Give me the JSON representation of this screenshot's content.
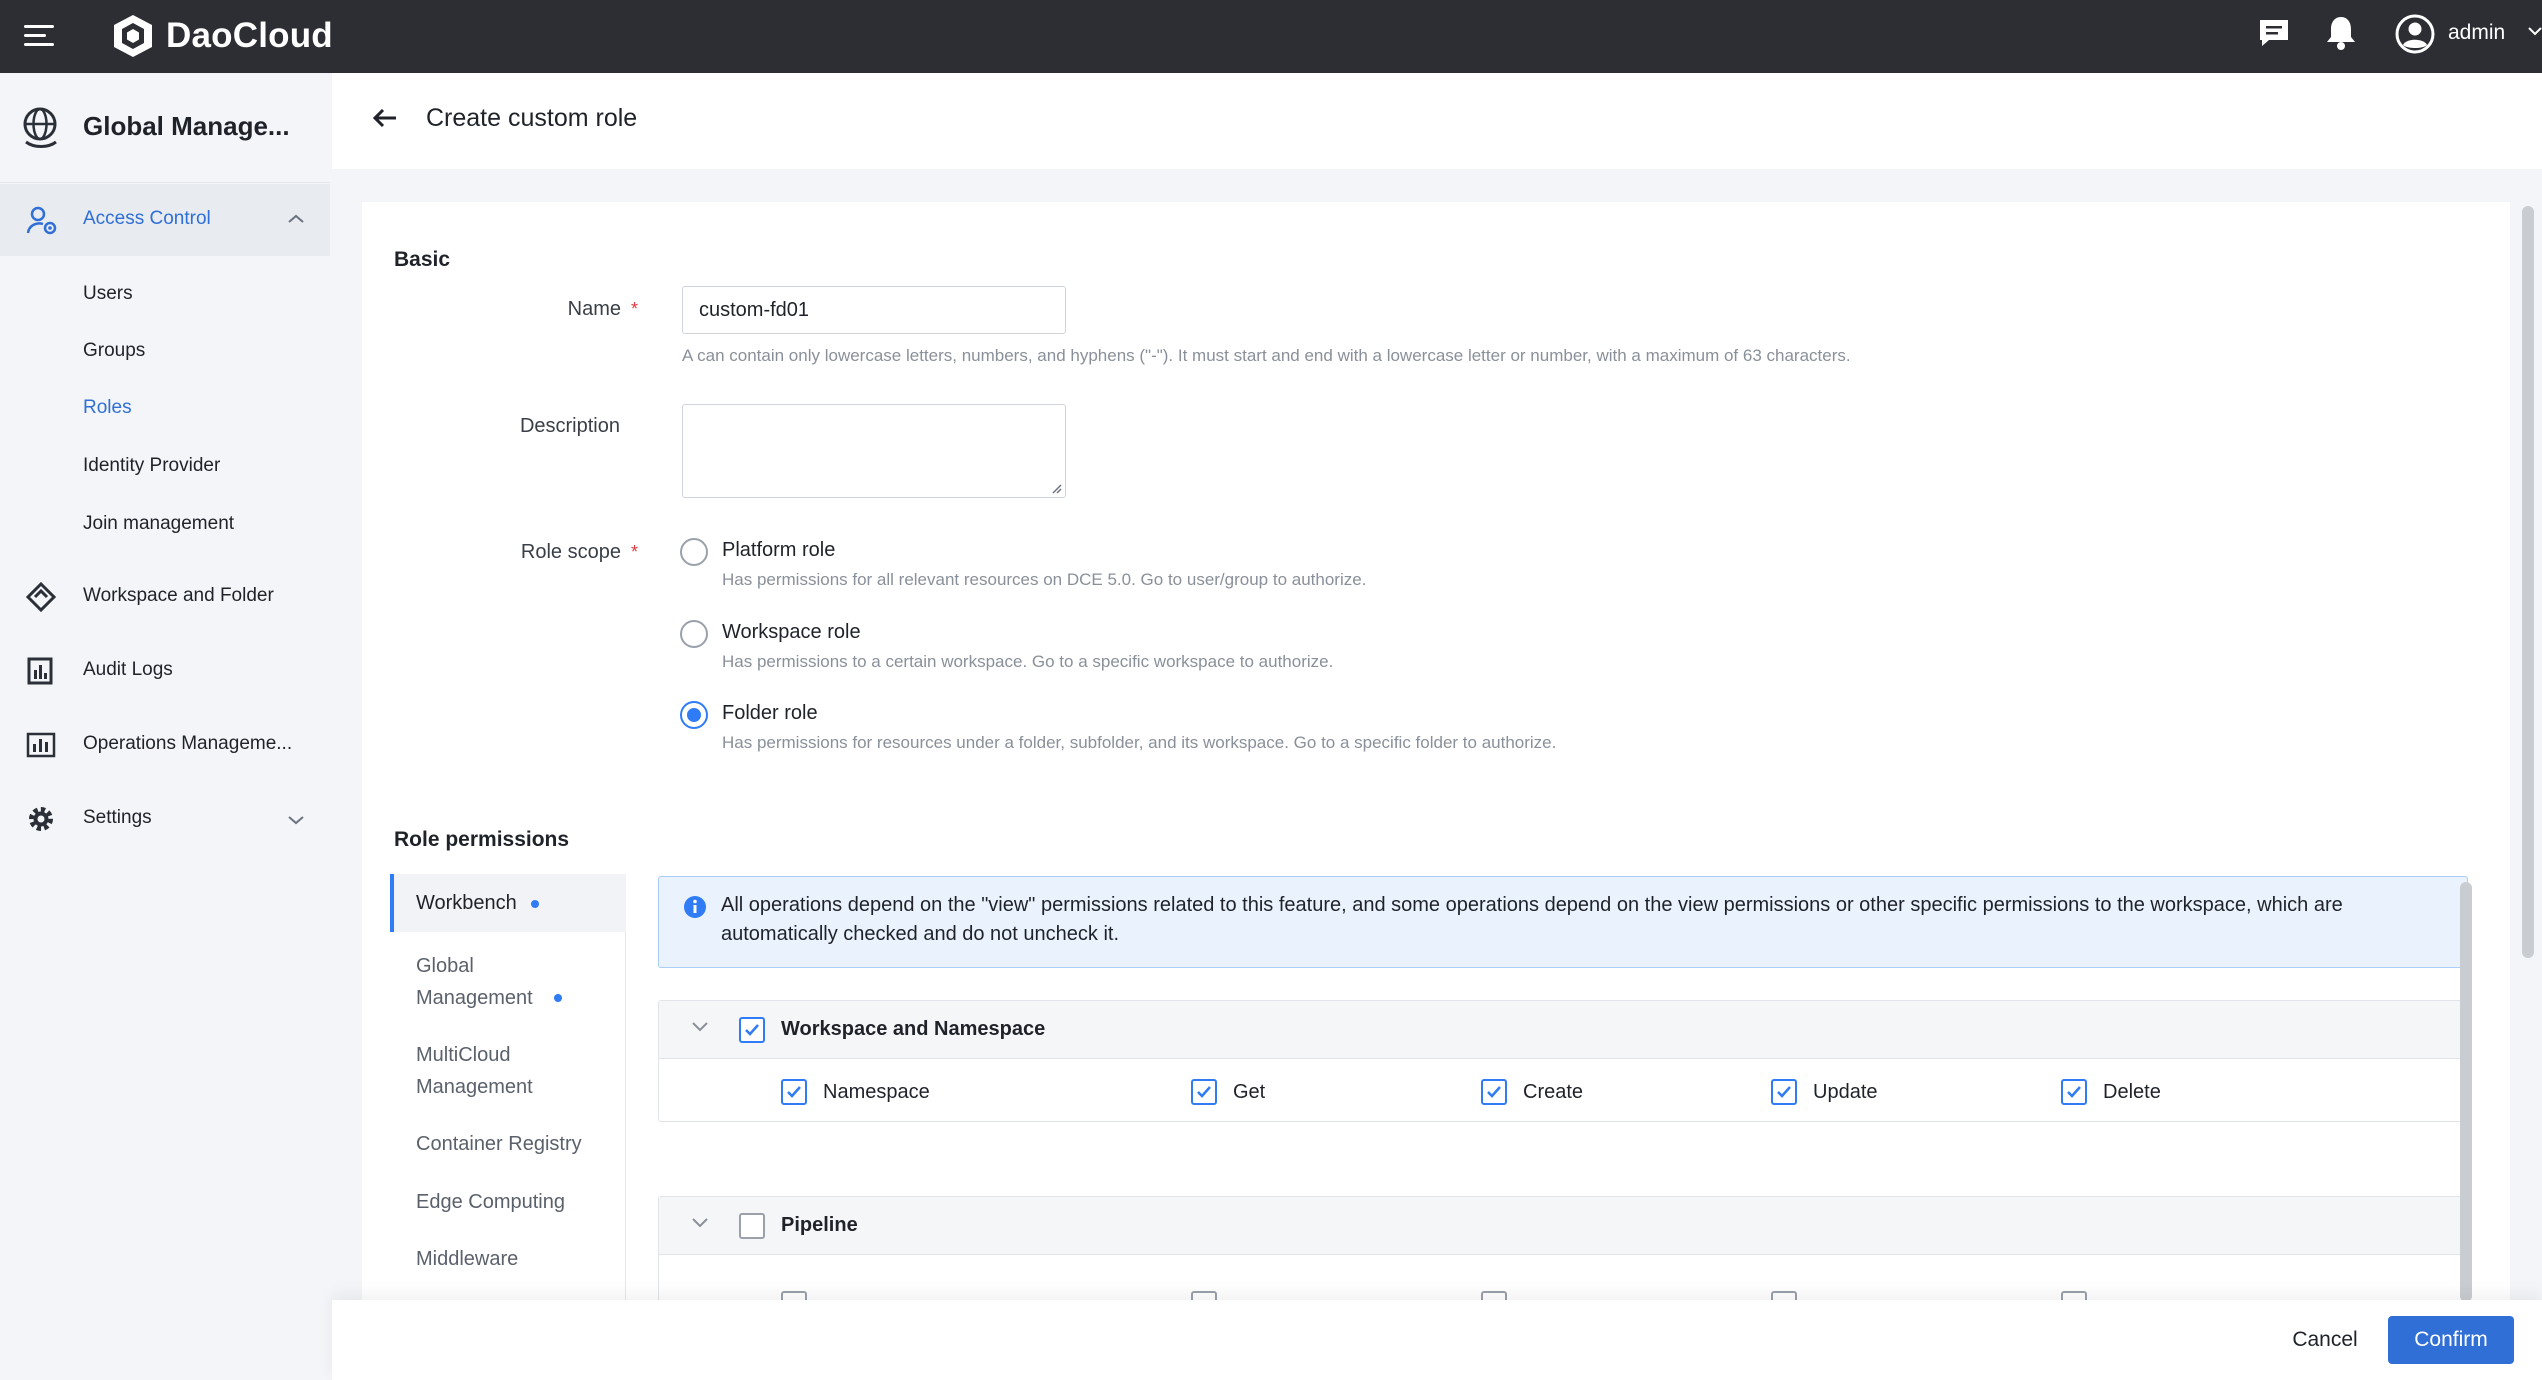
{
  "app": {
    "brand": "DaoCloud",
    "user": "admin"
  },
  "icons": {
    "menu": "hamburger-icon",
    "message": "message-icon",
    "notification": "bell-icon",
    "user": "user-avatar-icon",
    "back": "arrow-left-icon",
    "info": "info-icon"
  },
  "colors": {
    "accent": "#2f6fd6",
    "topbar": "#2c2e33",
    "required": "#e0383e"
  },
  "sidebar": {
    "title": "Global Manage...",
    "sections": [
      {
        "label": "Access Control",
        "expanded": true
      },
      {
        "label": "Workspace and Folder"
      },
      {
        "label": "Audit Logs"
      },
      {
        "label": "Operations Manageme..."
      },
      {
        "label": "Settings"
      }
    ],
    "access_items": [
      "Users",
      "Groups",
      "Roles",
      "Identity Provider",
      "Join management"
    ],
    "active_item": "Roles"
  },
  "page": {
    "title": "Create custom role"
  },
  "basic": {
    "section_title": "Basic",
    "name_label": "Name",
    "name_value": "custom-fd01",
    "name_hint": "A can contain only lowercase letters, numbers, and hyphens (\"-\"). It must start and end with a lowercase letter or number, with a maximum of 63 characters.",
    "description_label": "Description",
    "description_value": "",
    "scope_label": "Role scope",
    "scopes": [
      {
        "label": "Platform role",
        "desc": "Has permissions for all relevant resources on DCE 5.0. Go to user/group to authorize.",
        "checked": false
      },
      {
        "label": "Workspace role",
        "desc": "Has permissions to a certain workspace. Go to a specific workspace to authorize.",
        "checked": false
      },
      {
        "label": "Folder role",
        "desc": "Has permissions for resources under a folder, subfolder, and its workspace. Go to a specific folder to authorize.",
        "checked": true
      }
    ]
  },
  "permissions": {
    "section_title": "Role permissions",
    "tabs": [
      {
        "label": "Workbench",
        "dot": true,
        "active": true
      },
      {
        "label": "Global Management",
        "dot": true
      },
      {
        "label": "MultiCloud Management"
      },
      {
        "label": "Container Registry"
      },
      {
        "label": "Edge Computing"
      },
      {
        "label": "Middleware"
      }
    ],
    "info": "All operations depend on the \"view\" permissions related to this feature, and some operations depend on the view permissions or other specific permissions to the workspace, which are automatically checked and do not uncheck it.",
    "groups": [
      {
        "title": "Workspace and Namespace",
        "checked": true,
        "items": [
          {
            "label": "Namespace",
            "checked": true
          },
          {
            "label": "Get",
            "checked": true
          },
          {
            "label": "Create",
            "checked": true
          },
          {
            "label": "Update",
            "checked": true
          },
          {
            "label": "Delete",
            "checked": true
          }
        ]
      },
      {
        "title": "Pipeline",
        "checked": false
      }
    ]
  },
  "footer": {
    "cancel": "Cancel",
    "confirm": "Confirm"
  }
}
